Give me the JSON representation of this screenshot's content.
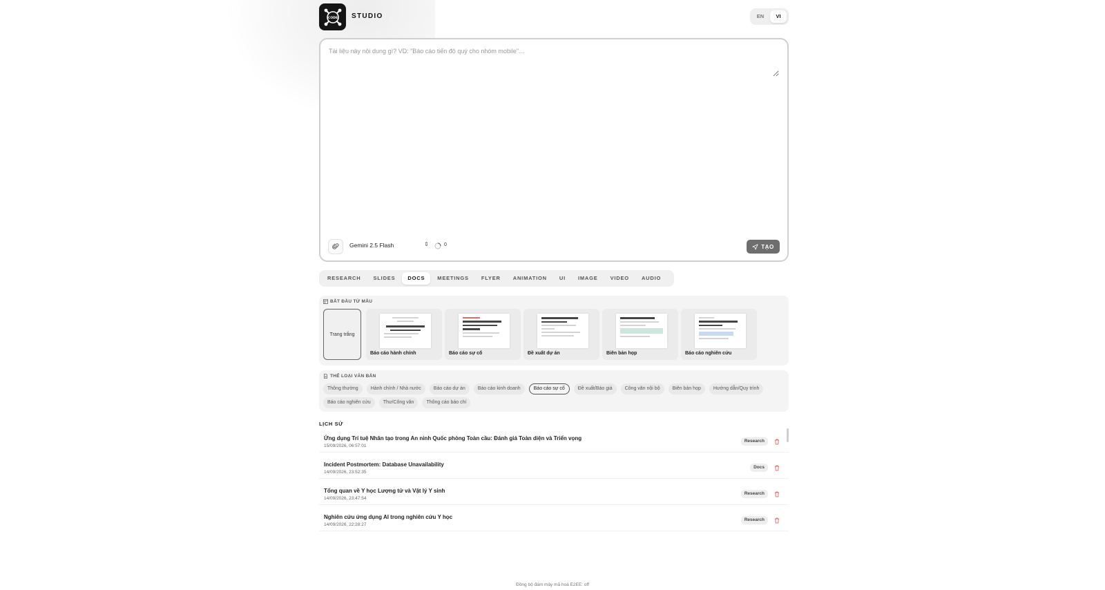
{
  "brand": {
    "logo_text": "CODE",
    "name": "STUDIO"
  },
  "lang": [
    "EN",
    "VI"
  ],
  "lang_active": "VI",
  "composer": {
    "placeholder": "Tài liệu này nội dung gì? VD: \"Báo cáo tiến độ quý cho nhóm mobile\"...",
    "model": "Gemini 2.5 Flash",
    "credits": "0",
    "create_label": "TẠO"
  },
  "tabs": [
    "RESEARCH",
    "SLIDES",
    "DOCS",
    "MEETINGS",
    "FLYER",
    "ANIMATION",
    "UI",
    "IMAGE",
    "VIDEO",
    "AUDIO"
  ],
  "tab_active": "DOCS",
  "templates": {
    "label": "BẮT ĐẦU TỪ MẪU",
    "blank": "Trang trắng",
    "items": [
      {
        "name": "Báo cáo hành chính",
        "preview_title": "BÁO CÁO KẾT QUẢ CHƯƠNG TRÌNH THI ĐIỂM HỌC SINH BIÊN TO LỚP TIỂU HỌC"
      },
      {
        "name": "Báo cáo sự cố",
        "preview_title": "Checkout API returned elevated 5xx errors for 47 minutes"
      },
      {
        "name": "Đề xuất dự án",
        "preview_title": "Automating monthly close reconciliation"
      },
      {
        "name": "Biên bản họp",
        "preview_title": "Q3 planning – priorities & resourcing"
      },
      {
        "name": "Báo cáo nghiên cứu",
        "preview_title": "Why the signup flow loses a third of visitors at step 2"
      }
    ]
  },
  "doc_types": {
    "label": "THỂ LOẠI VĂN BẢN",
    "items": [
      "Thông thường",
      "Hành chính / Nhà nước",
      "Báo cáo dự án",
      "Báo cáo kinh doanh",
      "Báo cáo sự cố",
      "Đề xuất/Báo giá",
      "Công văn nội bộ",
      "Biên bản họp",
      "Hướng dẫn/Quy trình",
      "Báo cáo nghiên cứu",
      "Thư/Công văn",
      "Thông cáo báo chí"
    ],
    "active": "Báo cáo sự cố"
  },
  "history": {
    "title": "LỊCH SỬ",
    "items": [
      {
        "title": "Ứng dụng Trí tuệ Nhân tạo trong An ninh Quốc phòng Toàn cầu: Đánh giá Toàn diện và Triển vọng",
        "date": "15/09/2026, 06:57:01",
        "badge": "Research"
      },
      {
        "title": "Incident Postmortem: Database Unavailability",
        "date": "14/09/2026, 23:52:35",
        "badge": "Docs"
      },
      {
        "title": "Tổng quan về Y học Lượng tử và Vật lý Y sinh",
        "date": "14/09/2026, 23:47:54",
        "badge": "Research"
      },
      {
        "title": "Nghiên cứu ứng dụng AI trong nghiên cứu Y học",
        "date": "14/09/2026, 22:28:27",
        "badge": "Research"
      }
    ]
  },
  "footer": "Đồng bộ đám mây mã hoá E2EE: off",
  "colors": {
    "delete": "#d9534f",
    "create_button": "#6e6e6e",
    "logo_bg": "#151515"
  }
}
